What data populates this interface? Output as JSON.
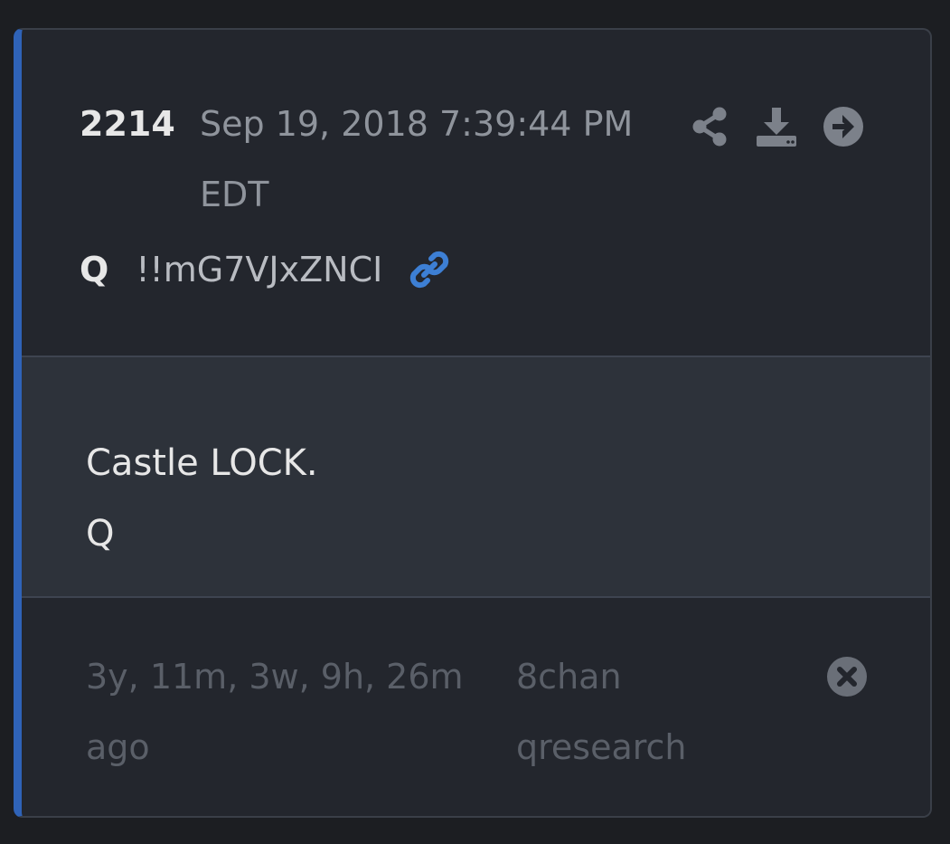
{
  "post": {
    "number": "2214",
    "timestamp": "Sep 19, 2018 7:39:44 PM EDT",
    "author": "Q",
    "tripcode": "!!mG7VJxZNCI",
    "body": "Castle LOCK.\nQ"
  },
  "footer": {
    "elapsed": "3y, 11m, 3w, 9h, 26m ago",
    "source": "8chan qresearch"
  },
  "icons": {
    "share": "share-icon",
    "download": "download-icon",
    "goto": "arrow-circle-right-icon",
    "link": "link-icon",
    "close": "close-circle-icon"
  },
  "colors": {
    "accent": "#2f63b8",
    "link": "#3d7fd4",
    "icon": "#7c818a"
  }
}
